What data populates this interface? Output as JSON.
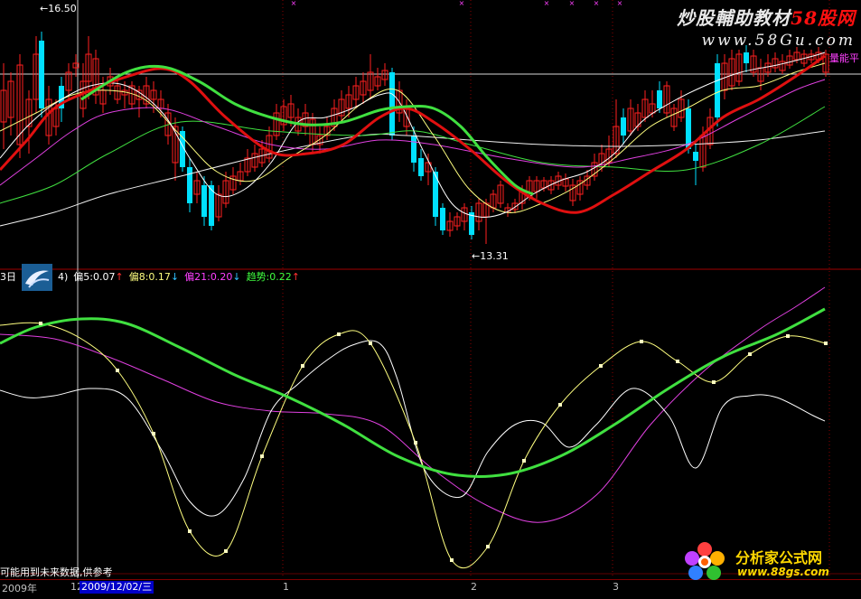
{
  "main_chart": {
    "high_marker": "16.50",
    "low_marker": "13.31",
    "right_label": "量能平"
  },
  "indicator": {
    "prefix": "3日",
    "suffix": "4)",
    "items": [
      {
        "label": "偏5:0.07",
        "arrow": "↑",
        "color": "#ffffff",
        "arrow_color": "#ff3030"
      },
      {
        "label": "偏8:0.17",
        "arrow": "↓",
        "color": "#ffff80",
        "arrow_color": "#30c0ff"
      },
      {
        "label": "偏21:0.20",
        "arrow": "↓",
        "color": "#ff40ff",
        "arrow_color": "#30c0ff"
      },
      {
        "label": "趋势:0.22",
        "arrow": "↑",
        "color": "#40ff40",
        "arrow_color": "#ff3030"
      }
    ]
  },
  "footer_note": "可能用到未来数据,供参考",
  "date_bar": {
    "year": "2009年",
    "selected_date": "2009/12/02/三",
    "month_marks": [
      "12",
      "1",
      "2",
      "3"
    ]
  },
  "watermark_top": {
    "line1_a": "炒股輔助教材",
    "line1_b": "58股网",
    "line2": "www.58Gu.com"
  },
  "watermark_bottom": {
    "title": "分析家公式网",
    "url": "www.88gs.com"
  },
  "colors": {
    "up": "#ff2020",
    "down": "#00e0ff",
    "ma_red": "#e01010",
    "ma_green": "#40e040",
    "ma_magenta": "#e040e0",
    "ma_white": "#f0f0f0",
    "ma_yellow": "#ffff80",
    "grid_red": "#8b0000"
  }
}
